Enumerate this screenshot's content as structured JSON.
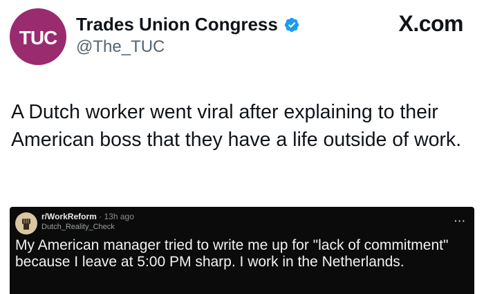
{
  "tweet": {
    "avatar_text": "TUC",
    "display_name": "Trades Union Congress",
    "handle": "@The_TUC",
    "text": "A Dutch worker went viral after explaining to their American boss that they have a life outside of work."
  },
  "brand": {
    "label": "X.com"
  },
  "reddit_card": {
    "subreddit": "r/WorkReform",
    "separator": "·",
    "time_ago": "13h ago",
    "username": "Dutch_Reality_Check",
    "title": "My American manager tried to write me up for \"lack of commitment\" because I leave at 5:00 PM sharp. I work in the Netherlands.",
    "more_icon": "more-dots-icon"
  },
  "colors": {
    "avatar_bg": "#9b2b6f",
    "verified_blue": "#1d9bf0",
    "card_bg": "#0b0b0b",
    "handle_gray": "#536471"
  }
}
